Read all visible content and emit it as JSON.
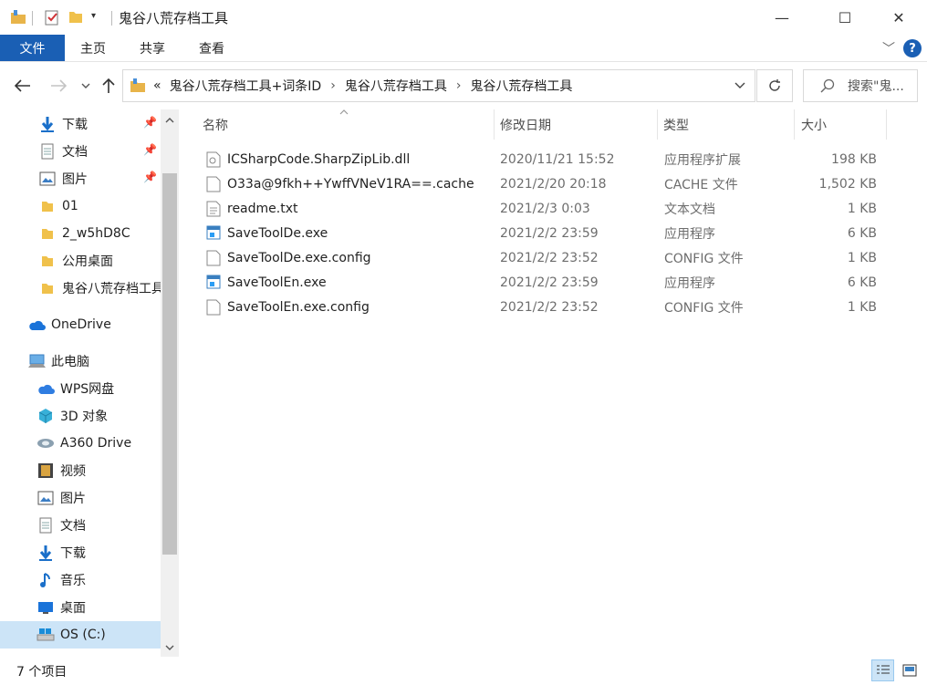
{
  "window": {
    "title": "鬼谷八荒存档工具",
    "minimize": "—",
    "maximize": "☐",
    "close": "✕"
  },
  "ribbon": {
    "tabs": [
      "文件",
      "主页",
      "共享",
      "查看"
    ]
  },
  "address": {
    "overflow": "«",
    "crumbs": [
      "鬼谷八荒存档工具+词条ID",
      "鬼谷八荒存档工具"
    ],
    "search_placeholder": "搜索\"鬼..."
  },
  "sidebar": {
    "items": [
      {
        "label": "下载",
        "icon": "download-icon",
        "pinned": true
      },
      {
        "label": "文档",
        "icon": "document-icon",
        "pinned": true
      },
      {
        "label": "图片",
        "icon": "picture-icon",
        "pinned": true
      },
      {
        "label": "01",
        "icon": "folder-icon",
        "pinned": false
      },
      {
        "label": "2_w5hD8C",
        "icon": "folder-icon",
        "pinned": false
      },
      {
        "label": "公用桌面",
        "icon": "folder-icon",
        "pinned": false
      },
      {
        "label": "鬼谷八荒存档工具",
        "icon": "folder-icon",
        "pinned": false
      },
      {
        "label": "OneDrive",
        "icon": "cloud-icon",
        "pinned": false
      },
      {
        "label": "此电脑",
        "icon": "computer-icon",
        "pinned": false
      },
      {
        "label": "WPS网盘",
        "icon": "cloud-icon",
        "pinned": false
      },
      {
        "label": "3D 对象",
        "icon": "cube-icon",
        "pinned": false
      },
      {
        "label": "A360 Drive",
        "icon": "a360-icon",
        "pinned": false
      },
      {
        "label": "视频",
        "icon": "video-icon",
        "pinned": false
      },
      {
        "label": "图片",
        "icon": "picture-icon",
        "pinned": false
      },
      {
        "label": "文档",
        "icon": "document-icon",
        "pinned": false
      },
      {
        "label": "下载",
        "icon": "download-icon",
        "pinned": false
      },
      {
        "label": "音乐",
        "icon": "music-icon",
        "pinned": false
      },
      {
        "label": "桌面",
        "icon": "desktop-icon",
        "pinned": false
      },
      {
        "label": "OS (C:)",
        "icon": "drive-icon",
        "pinned": false,
        "selected": true
      }
    ]
  },
  "columns": {
    "name": "名称",
    "date": "修改日期",
    "type": "类型",
    "size": "大小"
  },
  "files": [
    {
      "name": "ICSharpCode.SharpZipLib.dll",
      "date": "2020/11/21 15:52",
      "type": "应用程序扩展",
      "size": "198 KB",
      "icon": "dll-icon"
    },
    {
      "name": "O33a@9fkh++YwffVNeV1RA==.cache",
      "date": "2021/2/20 20:18",
      "type": "CACHE 文件",
      "size": "1,502 KB",
      "icon": "file-icon"
    },
    {
      "name": "readme.txt",
      "date": "2021/2/3 0:03",
      "type": "文本文档",
      "size": "1 KB",
      "icon": "text-file-icon"
    },
    {
      "name": "SaveToolDe.exe",
      "date": "2021/2/2 23:59",
      "type": "应用程序",
      "size": "6 KB",
      "icon": "exe-icon"
    },
    {
      "name": "SaveToolDe.exe.config",
      "date": "2021/2/2 23:52",
      "type": "CONFIG 文件",
      "size": "1 KB",
      "icon": "file-icon"
    },
    {
      "name": "SaveToolEn.exe",
      "date": "2021/2/2 23:59",
      "type": "应用程序",
      "size": "6 KB",
      "icon": "exe-icon"
    },
    {
      "name": "SaveToolEn.exe.config",
      "date": "2021/2/2 23:52",
      "type": "CONFIG 文件",
      "size": "1 KB",
      "icon": "file-icon"
    }
  ],
  "status": {
    "count": "7 个项目"
  }
}
